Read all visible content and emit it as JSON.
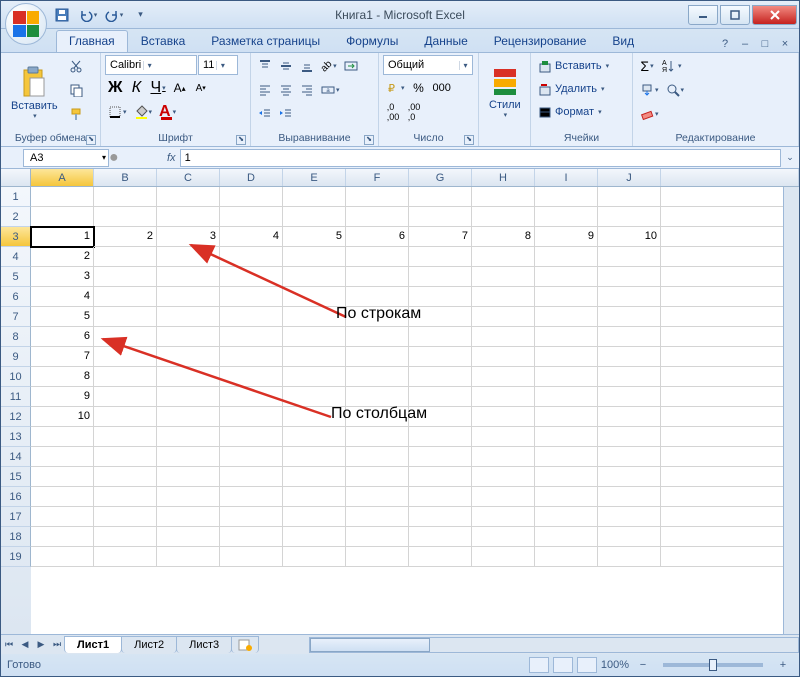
{
  "window": {
    "title": "Книга1 - Microsoft Excel"
  },
  "qat": {
    "save": "save",
    "undo": "undo",
    "redo": "redo"
  },
  "tabs": {
    "items": [
      "Главная",
      "Вставка",
      "Разметка страницы",
      "Формулы",
      "Данные",
      "Рецензирование",
      "Вид"
    ],
    "active": 0
  },
  "ribbon": {
    "clipboard": {
      "label": "Буфер обмена",
      "paste": "Вставить"
    },
    "font": {
      "label": "Шрифт",
      "name": "Calibri",
      "size": "11"
    },
    "alignment": {
      "label": "Выравнивание"
    },
    "number": {
      "label": "Число",
      "format": "Общий"
    },
    "styles": {
      "label": "Стили",
      "btn": "Стили"
    },
    "cells": {
      "label": "Ячейки",
      "insert": "Вставить",
      "delete": "Удалить",
      "format": "Формат"
    },
    "editing": {
      "label": "Редактирование"
    }
  },
  "formula_bar": {
    "name_box": "A3",
    "fx": "fx",
    "value": "1"
  },
  "grid": {
    "columns": [
      "A",
      "B",
      "C",
      "D",
      "E",
      "F",
      "G",
      "H",
      "I",
      "J"
    ],
    "rows": [
      "1",
      "2",
      "3",
      "4",
      "5",
      "6",
      "7",
      "8",
      "9",
      "10",
      "11",
      "12",
      "13",
      "14",
      "15",
      "16",
      "17",
      "18",
      "19"
    ],
    "active_cell": "A3",
    "data_row3": [
      "1",
      "2",
      "3",
      "4",
      "5",
      "6",
      "7",
      "8",
      "9",
      "10"
    ],
    "data_colA": {
      "4": "2",
      "5": "3",
      "6": "4",
      "7": "5",
      "8": "6",
      "9": "7",
      "10": "8",
      "11": "9",
      "12": "10"
    }
  },
  "annotations": {
    "rows": "По строкам",
    "cols": "По столбцам"
  },
  "sheets": {
    "items": [
      "Лист1",
      "Лист2",
      "Лист3"
    ],
    "active": 0
  },
  "status": {
    "ready": "Готово",
    "zoom": "100%"
  }
}
